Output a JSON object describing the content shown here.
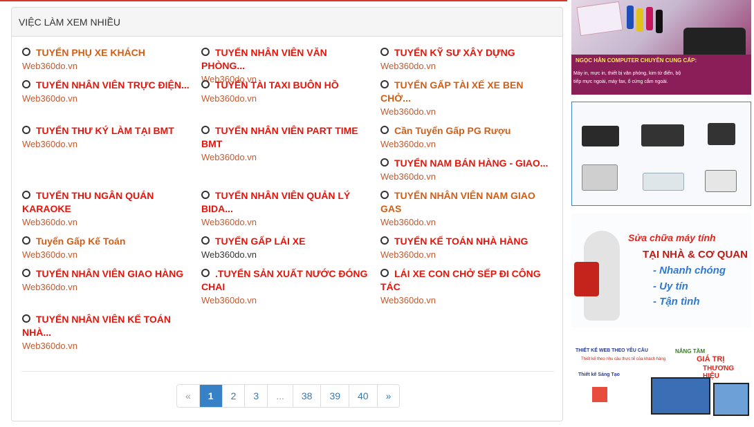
{
  "panel": {
    "title": "VIỆC LÀM XEM NHIỀU"
  },
  "jobs": [
    {
      "title": "TUYỂN PHỤ XE KHÁCH",
      "site": "Web360do.vn"
    },
    {
      "title": "TUYỂN NHÂN VIÊN VĂN PHÒNG...",
      "site": "Web360do.vn"
    },
    {
      "title": "TUYỂN KỸ SƯ XÂY DỰNG",
      "site": "Web360do.vn"
    },
    {
      "title": "TUYỂN NHÂN VIÊN TRỰC ĐIỆN...",
      "site": "Web360do.vn"
    },
    {
      "title": "TUYỂN TÀI TAXI BUÔN HỒ",
      "site": "Web360do.vn"
    },
    {
      "title": "TUYỂN GẤP TÀI XẾ XE BEN CHỞ...",
      "site": "Web360do.vn"
    },
    {
      "title": "TUYỂN THƯ KÝ LÀM TẠI BMT",
      "site": "Web360do.vn"
    },
    {
      "title": "TUYỂN NHÂN VIÊN PART TIME BMT",
      "site": "Web360do.vn"
    },
    {
      "title": "Cần Tuyển Gấp PG Rượu",
      "site": "Web360do.vn"
    },
    {
      "title": "TUYỂN NAM BÁN HÀNG - GIAO...",
      "site": "Web360do.vn"
    },
    {
      "title": "TUYỂN THU NGÂN QUÁN KARAOKE",
      "site": "Web360do.vn"
    },
    {
      "title": "TUYỂN NHÂN VIÊN QUẢN LÝ BIDA...",
      "site": "Web360do.vn"
    },
    {
      "title": "TUYỂN NHÂN VIÊN NAM GIAO GAS",
      "site": "Web360do.vn"
    },
    {
      "title": "Tuyển Gấp Kế Toán",
      "site": "Web360do.vn"
    },
    {
      "title": "TUYỂN GẤP LÁI XE",
      "site": "Web360do.vn"
    },
    {
      "title": "TUYỂN KẾ TOÁN NHÀ HÀNG",
      "site": "Web360do.vn"
    },
    {
      "title": "TUYỂN NHÂN VIÊN GIAO HÀNG",
      "site": "Web360do.vn"
    },
    {
      "title": ".TUYỂN SẢN XUẤT NƯỚC ĐÓNG CHAI",
      "site": "Web360do.vn"
    },
    {
      "title": "LÁI XE CON CHỞ SẾP ĐI CÔNG TÁC",
      "site": "Web360do.vn"
    },
    {
      "title": "TUYỂN NHÂN VIÊN KẾ TOÁN NHÀ...",
      "site": "Web360do.vn"
    }
  ],
  "pagination": {
    "prev": "«",
    "p1": "1",
    "p2": "2",
    "p3": "3",
    "ellipsis": "...",
    "p38": "38",
    "p39": "39",
    "p40": "40",
    "next": "»"
  },
  "ads": {
    "ad1": {
      "headline": "NGỌC HÂN COMPUTER CHUYÊN CUNG CẤP:",
      "body": "Máy in, mực in, thiết bị văn phòng, kim từ điển, bộ tiếp mực ngoài, máy fax, ổ cứng cắm ngoài."
    },
    "ad3": {
      "line1": "Sửa chữa máy tính",
      "line2": "TẠI NHÀ & CƠ QUAN",
      "b1": "- Nhanh chóng",
      "b2": "- Uy tín",
      "b3": "- Tận tình"
    },
    "ad4": {
      "s1": "THIẾT KẾ WEB THEO YÊU CẦU",
      "s2": "Thiết kế theo nhu cầu thực tế của khách hàng",
      "s3": "Thiết kế Sáng Tạo",
      "n1": "NÂNG TẦM",
      "n2": "GIÁ TRỊ",
      "n3": "THƯƠNG HIỆU"
    }
  }
}
